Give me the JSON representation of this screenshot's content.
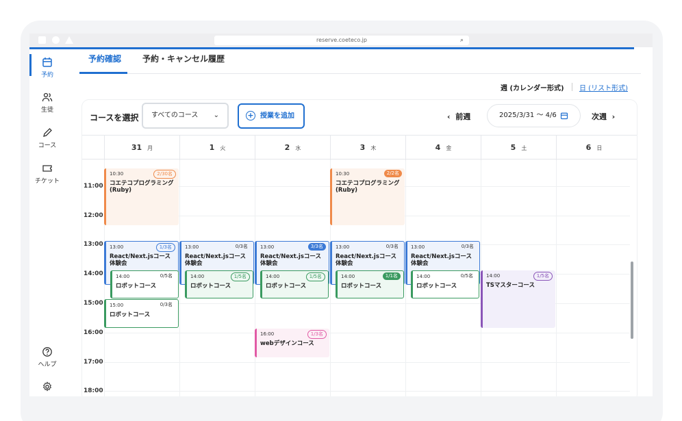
{
  "browser": {
    "url": "reserve.coeteco.jp"
  },
  "sidebar": {
    "items": [
      {
        "label": "予約",
        "icon": "calendar-icon"
      },
      {
        "label": "生徒",
        "icon": "users-icon"
      },
      {
        "label": "コース",
        "icon": "pen-icon"
      },
      {
        "label": "チケット",
        "icon": "ticket-icon"
      },
      {
        "label": "ヘルプ",
        "icon": "help-icon"
      },
      {
        "label": "",
        "icon": "gear-icon"
      }
    ]
  },
  "tabs": [
    {
      "label": "予約確認"
    },
    {
      "label": "予約・キャンセル履歴"
    }
  ],
  "view": {
    "week": "週 (カレンダー形式)",
    "day": "日 (リスト形式)"
  },
  "toolbar": {
    "course_label": "コースを選択",
    "course_select": "すべてのコース",
    "add_button": "授業を追加",
    "prev": "前週",
    "date_range": "2025/3/31 〜 4/6",
    "next": "次週"
  },
  "days": [
    {
      "date": "31",
      "wd": "月"
    },
    {
      "date": "1",
      "wd": "火"
    },
    {
      "date": "2",
      "wd": "水"
    },
    {
      "date": "3",
      "wd": "木"
    },
    {
      "date": "4",
      "wd": "金"
    },
    {
      "date": "5",
      "wd": "土"
    },
    {
      "date": "6",
      "wd": "日"
    }
  ],
  "times": [
    "11:00",
    "12:00",
    "13:00",
    "14:00",
    "15:00",
    "16:00",
    "17:00",
    "18:00"
  ],
  "events": [
    {
      "time": "10:30",
      "cap": "2/30名",
      "name": "コエテコプログラミング (Ruby)"
    },
    {
      "time": "10:30",
      "cap": "2/2名",
      "name": "コエテコプログラミング (Ruby)"
    },
    {
      "time": "13:00",
      "cap": "1/3名",
      "name": "React/Next.jsコース体験会"
    },
    {
      "time": "13:00",
      "cap": "0/3名",
      "name": "React/Next.jsコース体験会"
    },
    {
      "time": "13:00",
      "cap": "3/3名",
      "name": "React/Next.jsコース体験会"
    },
    {
      "time": "13:00",
      "cap": "0/3名",
      "name": "React/Next.jsコース体験会"
    },
    {
      "time": "13:00",
      "cap": "0/3名",
      "name": "React/Next.jsコース体験会"
    },
    {
      "time": "14:00",
      "cap": "0/5名",
      "name": "ロボットコース"
    },
    {
      "time": "14:00",
      "cap": "1/5名",
      "name": "ロボットコース"
    },
    {
      "time": "14:00",
      "cap": "1/5名",
      "name": "ロボットコース"
    },
    {
      "time": "14:00",
      "cap": "1/1名",
      "name": "ロボットコース"
    },
    {
      "time": "14:00",
      "cap": "0/5名",
      "name": "ロボットコース"
    },
    {
      "time": "14:00",
      "cap": "1/5名",
      "name": "TSマスターコース"
    },
    {
      "time": "15:00",
      "cap": "0/3名",
      "name": "ロボットコース"
    },
    {
      "time": "16:00",
      "cap": "1/3名",
      "name": "webデザインコース"
    }
  ]
}
